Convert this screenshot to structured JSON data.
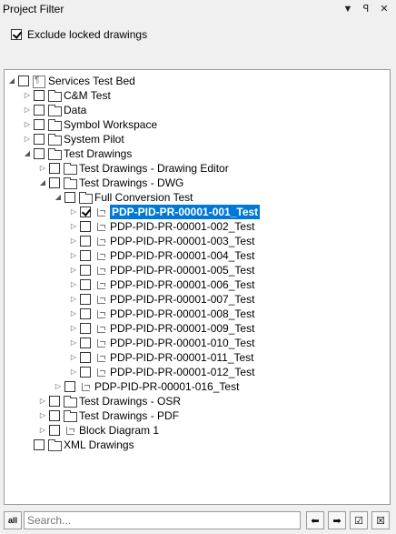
{
  "panel": {
    "title": "Project Filter",
    "menu_icon": "▼",
    "pin_icon": "ꟼ",
    "close_icon": "✕"
  },
  "exclude_locked": {
    "label": "Exclude locked drawings",
    "checked": true
  },
  "tree": [
    {
      "label": "Services Test Bed",
      "level": 0,
      "icon": "project",
      "expander": "expanded",
      "checked": false
    },
    {
      "label": "C&M Test",
      "level": 1,
      "icon": "folder",
      "expander": "collapsed",
      "checked": false
    },
    {
      "label": "Data",
      "level": 1,
      "icon": "folder",
      "expander": "collapsed",
      "checked": false
    },
    {
      "label": "Symbol Workspace",
      "level": 1,
      "icon": "folder",
      "expander": "collapsed",
      "checked": false
    },
    {
      "label": "System Pilot",
      "level": 1,
      "icon": "folder",
      "expander": "collapsed",
      "checked": false
    },
    {
      "label": "Test Drawings",
      "level": 1,
      "icon": "folder",
      "expander": "expanded",
      "checked": false
    },
    {
      "label": "Test Drawings - Drawing Editor",
      "level": 2,
      "icon": "folder",
      "expander": "collapsed",
      "checked": false
    },
    {
      "label": "Test Drawings - DWG",
      "level": 2,
      "icon": "folder",
      "expander": "expanded",
      "checked": false
    },
    {
      "label": "Full Conversion Test",
      "level": 3,
      "icon": "folder",
      "expander": "expanded",
      "checked": false
    },
    {
      "label": "PDP-PID-PR-00001-001_Test",
      "level": 4,
      "icon": "drawing",
      "expander": "collapsed",
      "checked": true,
      "selected": true
    },
    {
      "label": "PDP-PID-PR-00001-002_Test",
      "level": 4,
      "icon": "drawing",
      "expander": "collapsed",
      "checked": false
    },
    {
      "label": "PDP-PID-PR-00001-003_Test",
      "level": 4,
      "icon": "drawing",
      "expander": "collapsed",
      "checked": false
    },
    {
      "label": "PDP-PID-PR-00001-004_Test",
      "level": 4,
      "icon": "drawing",
      "expander": "collapsed",
      "checked": false
    },
    {
      "label": "PDP-PID-PR-00001-005_Test",
      "level": 4,
      "icon": "drawing",
      "expander": "collapsed",
      "checked": false
    },
    {
      "label": "PDP-PID-PR-00001-006_Test",
      "level": 4,
      "icon": "drawing",
      "expander": "collapsed",
      "checked": false
    },
    {
      "label": "PDP-PID-PR-00001-007_Test",
      "level": 4,
      "icon": "drawing",
      "expander": "collapsed",
      "checked": false
    },
    {
      "label": "PDP-PID-PR-00001-008_Test",
      "level": 4,
      "icon": "drawing",
      "expander": "collapsed",
      "checked": false
    },
    {
      "label": "PDP-PID-PR-00001-009_Test",
      "level": 4,
      "icon": "drawing",
      "expander": "collapsed",
      "checked": false
    },
    {
      "label": "PDP-PID-PR-00001-010_Test",
      "level": 4,
      "icon": "drawing",
      "expander": "collapsed",
      "checked": false
    },
    {
      "label": "PDP-PID-PR-00001-011_Test",
      "level": 4,
      "icon": "drawing",
      "expander": "collapsed",
      "checked": false
    },
    {
      "label": "PDP-PID-PR-00001-012_Test",
      "level": 4,
      "icon": "drawing",
      "expander": "collapsed",
      "checked": false
    },
    {
      "label": "PDP-PID-PR-00001-016_Test",
      "level": 3,
      "icon": "drawing",
      "expander": "collapsed",
      "checked": false
    },
    {
      "label": "Test Drawings - OSR",
      "level": 2,
      "icon": "folder",
      "expander": "collapsed",
      "checked": false
    },
    {
      "label": "Test Drawings - PDF",
      "level": 2,
      "icon": "folder",
      "expander": "collapsed",
      "checked": false
    },
    {
      "label": "Block Diagram 1",
      "level": 2,
      "icon": "drawing",
      "expander": "collapsed",
      "checked": false
    },
    {
      "label": "XML Drawings",
      "level": 1,
      "icon": "folder",
      "expander": "none",
      "checked": false
    }
  ],
  "bottom": {
    "filter_icon_label": "all",
    "search_placeholder": "Search...",
    "prev_icon": "⬅",
    "next_icon": "➡",
    "check_all_icon": "☑",
    "uncheck_icon": "☒"
  }
}
